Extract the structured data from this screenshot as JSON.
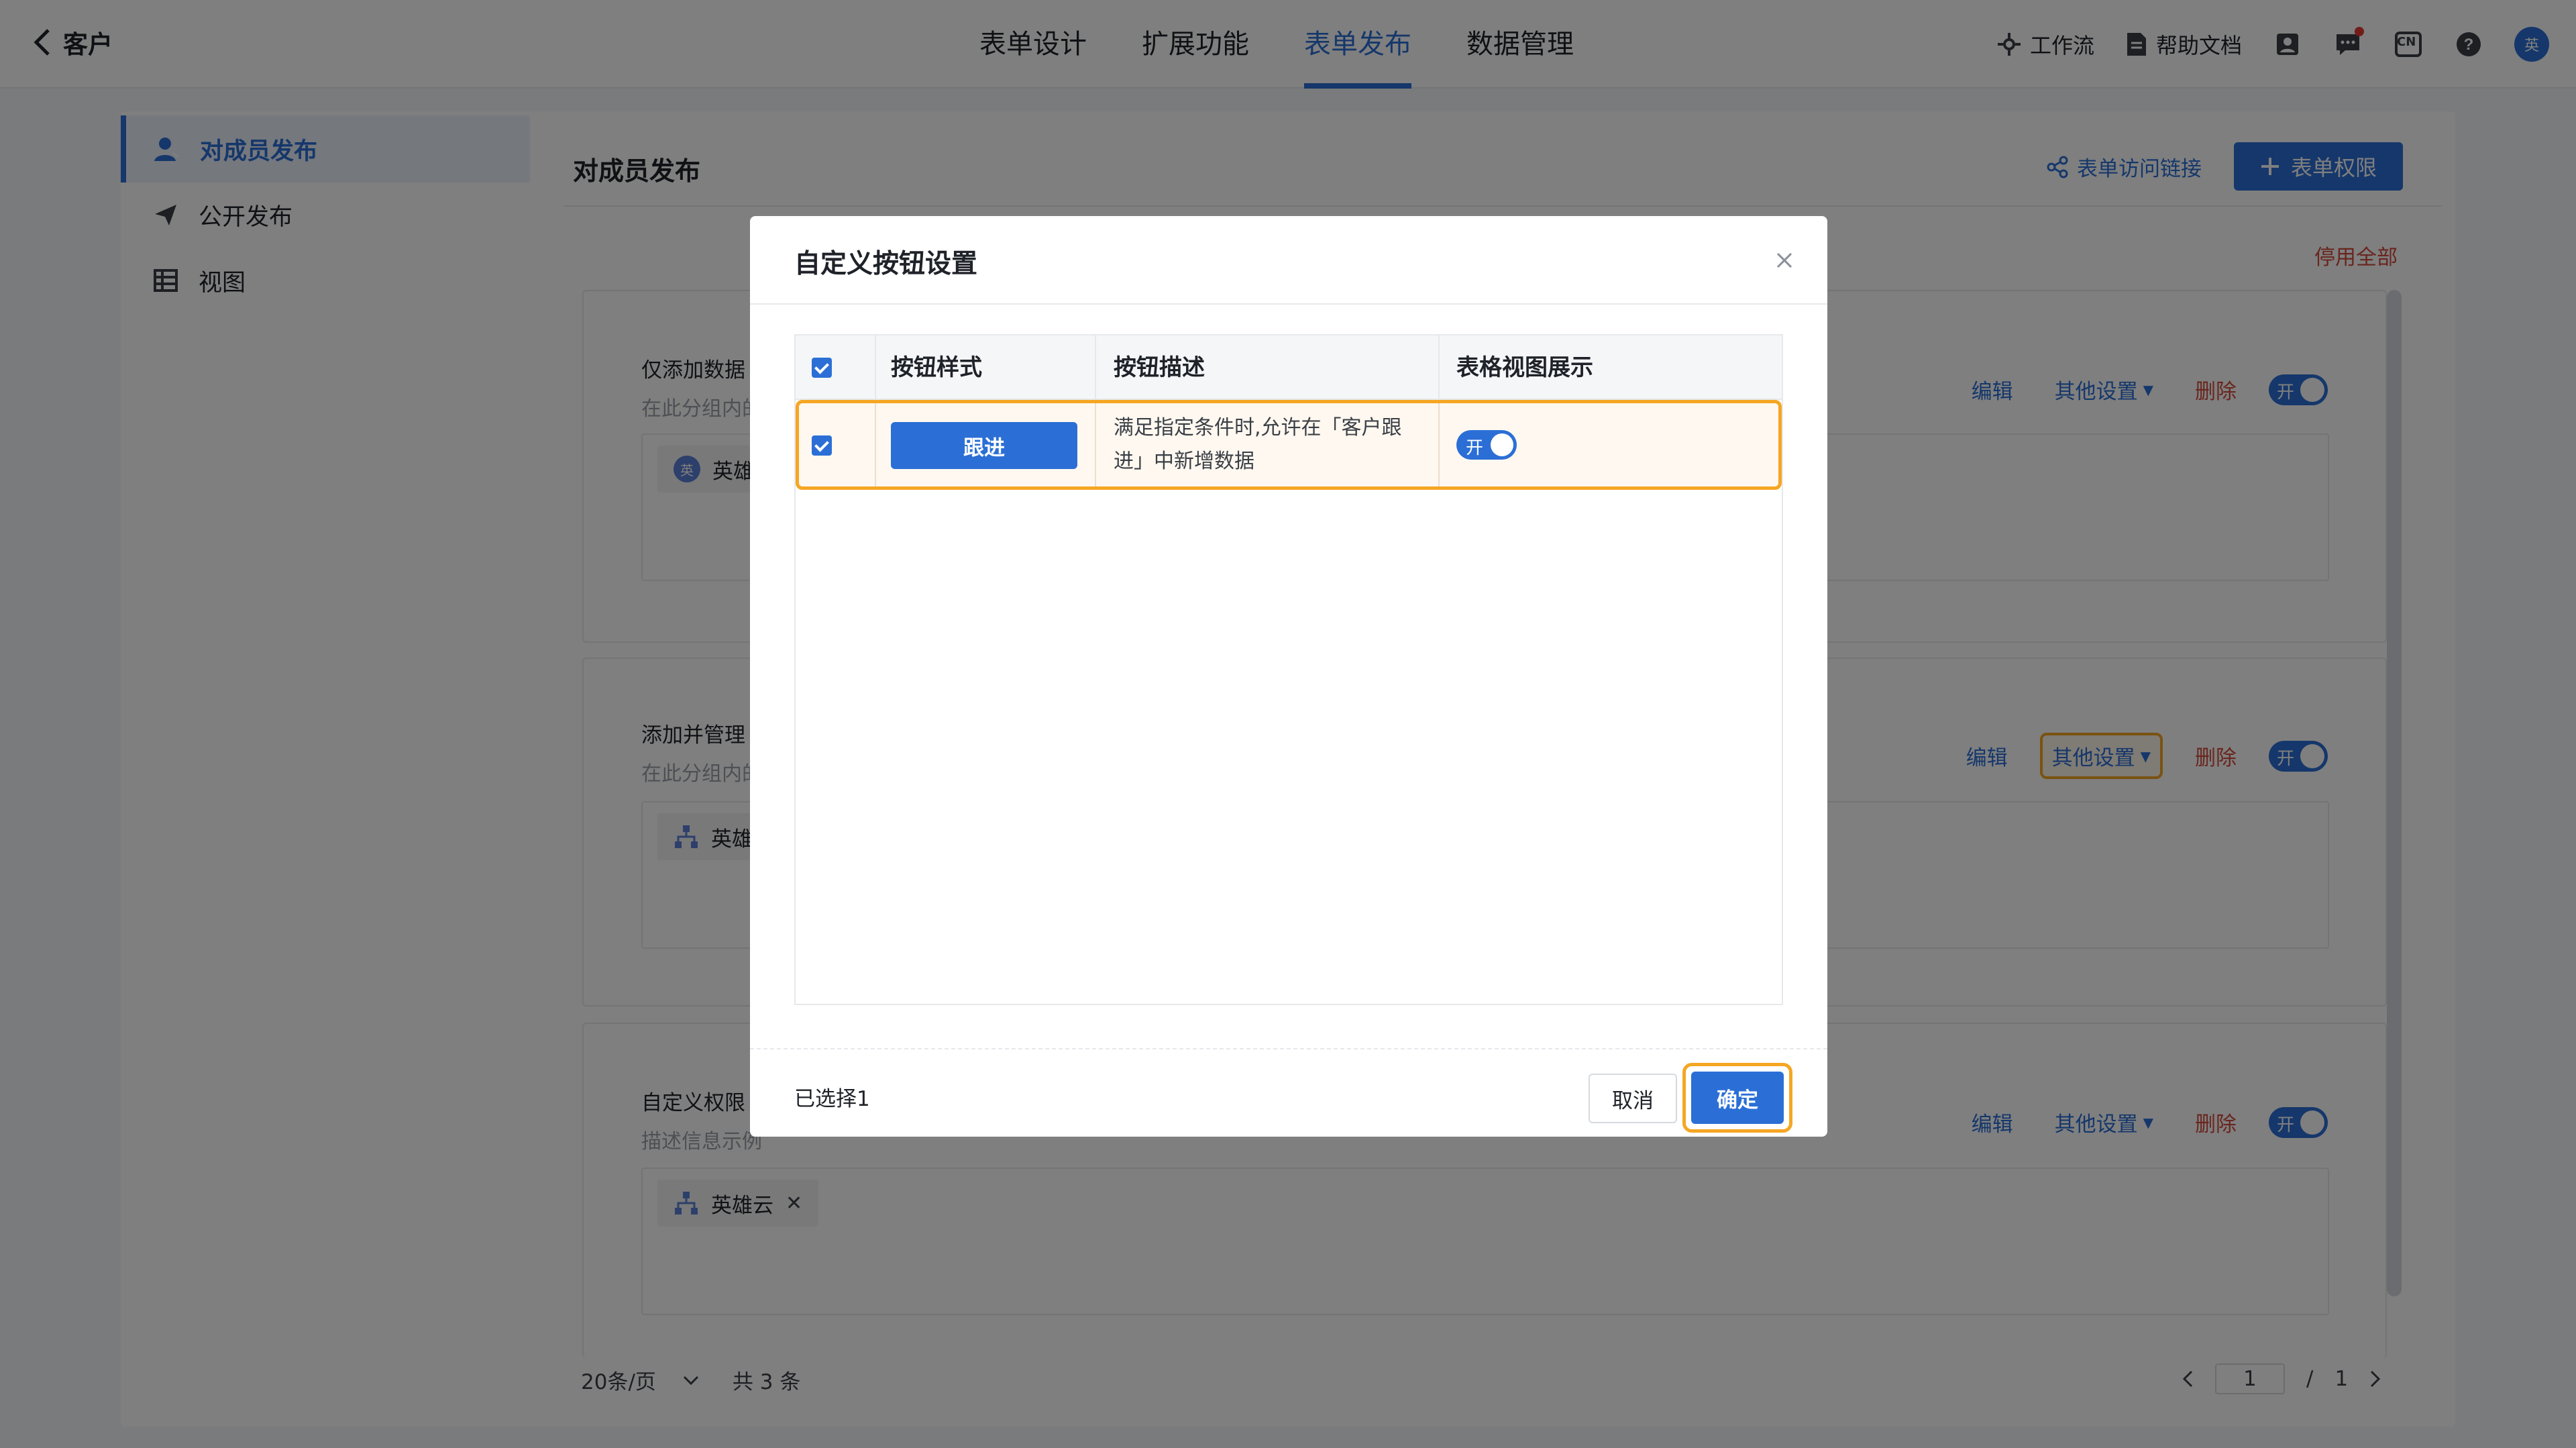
{
  "header": {
    "back_label": "客户",
    "tabs": [
      {
        "label": "表单设计"
      },
      {
        "label": "扩展功能"
      },
      {
        "label": "表单发布"
      },
      {
        "label": "数据管理"
      }
    ],
    "workflow_label": "工作流",
    "help_label": "帮助文档",
    "lang_label": "CN",
    "avatar_text": "英"
  },
  "sidebar": {
    "items": [
      {
        "label": "对成员发布",
        "icon": "user-icon"
      },
      {
        "label": "公开发布",
        "icon": "send-icon"
      },
      {
        "label": "视图",
        "icon": "table-icon"
      }
    ]
  },
  "main": {
    "title": "对成员发布",
    "link_label": "表单访问链接",
    "permission_label": "表单权限",
    "disable_all_label": "停用全部",
    "groups": [
      {
        "title": "仅添加数据",
        "desc": "在此分组内的",
        "chip": "英雄",
        "chip_icon": "英"
      },
      {
        "title": "添加并管理",
        "desc": "在此分组内的",
        "chip": "英雄"
      },
      {
        "title": "自定义权限",
        "desc": "描述信息示例",
        "chip": "英雄云"
      }
    ],
    "actions": {
      "edit": "编辑",
      "other": "其他设置",
      "delete": "删除",
      "switch_on": "开"
    },
    "pager": {
      "page_size": "20条/页",
      "total": "共 3 条",
      "current": "1",
      "separator": "/",
      "pages": "1"
    }
  },
  "modal": {
    "title": "自定义按钮设置",
    "columns": [
      "按钮样式",
      "按钮描述",
      "表格视图展示"
    ],
    "row": {
      "button_label": "跟进",
      "description": "满足指定条件时,允许在「客户跟进」中新增数据",
      "switch_label": "开"
    },
    "selected_count": "已选择1",
    "cancel_label": "取消",
    "confirm_label": "确定"
  },
  "colors": {
    "primary": "#2b6fd6",
    "highlight": "#f5a623",
    "danger": "#d24a3c"
  }
}
